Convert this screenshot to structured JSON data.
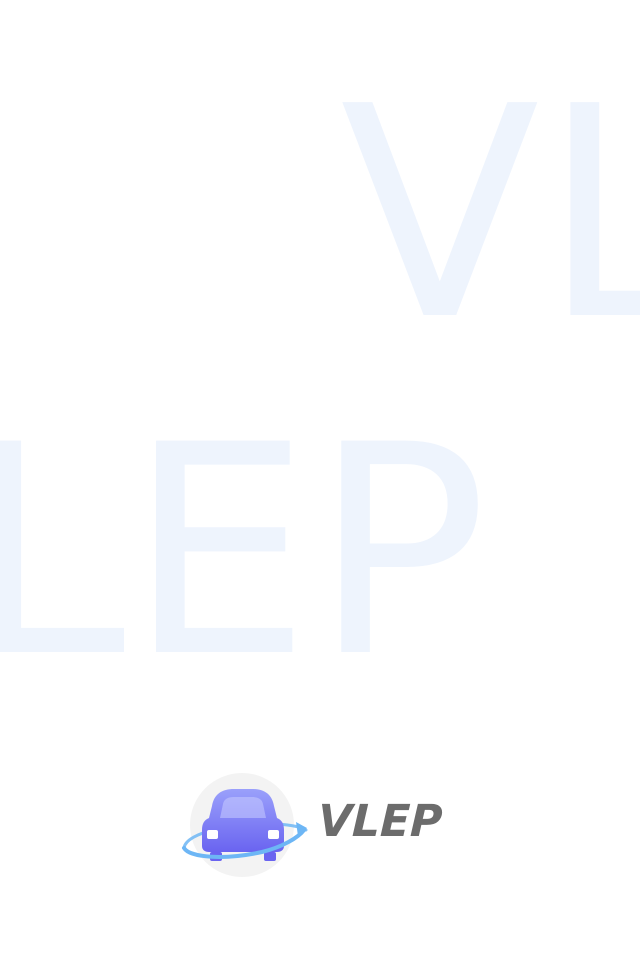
{
  "background": {
    "line_1": "VL",
    "line_2": "LEP",
    "color": "#eef4fd"
  },
  "brand": {
    "name": "VLEP",
    "icon": "car-orbit-icon",
    "colors": {
      "car_top": "#9aa0fb",
      "car_bottom": "#6a64f0",
      "orbit": "#6db6f5",
      "circle": "#f3f3f3",
      "wordmark": "#6c6c6c"
    }
  }
}
